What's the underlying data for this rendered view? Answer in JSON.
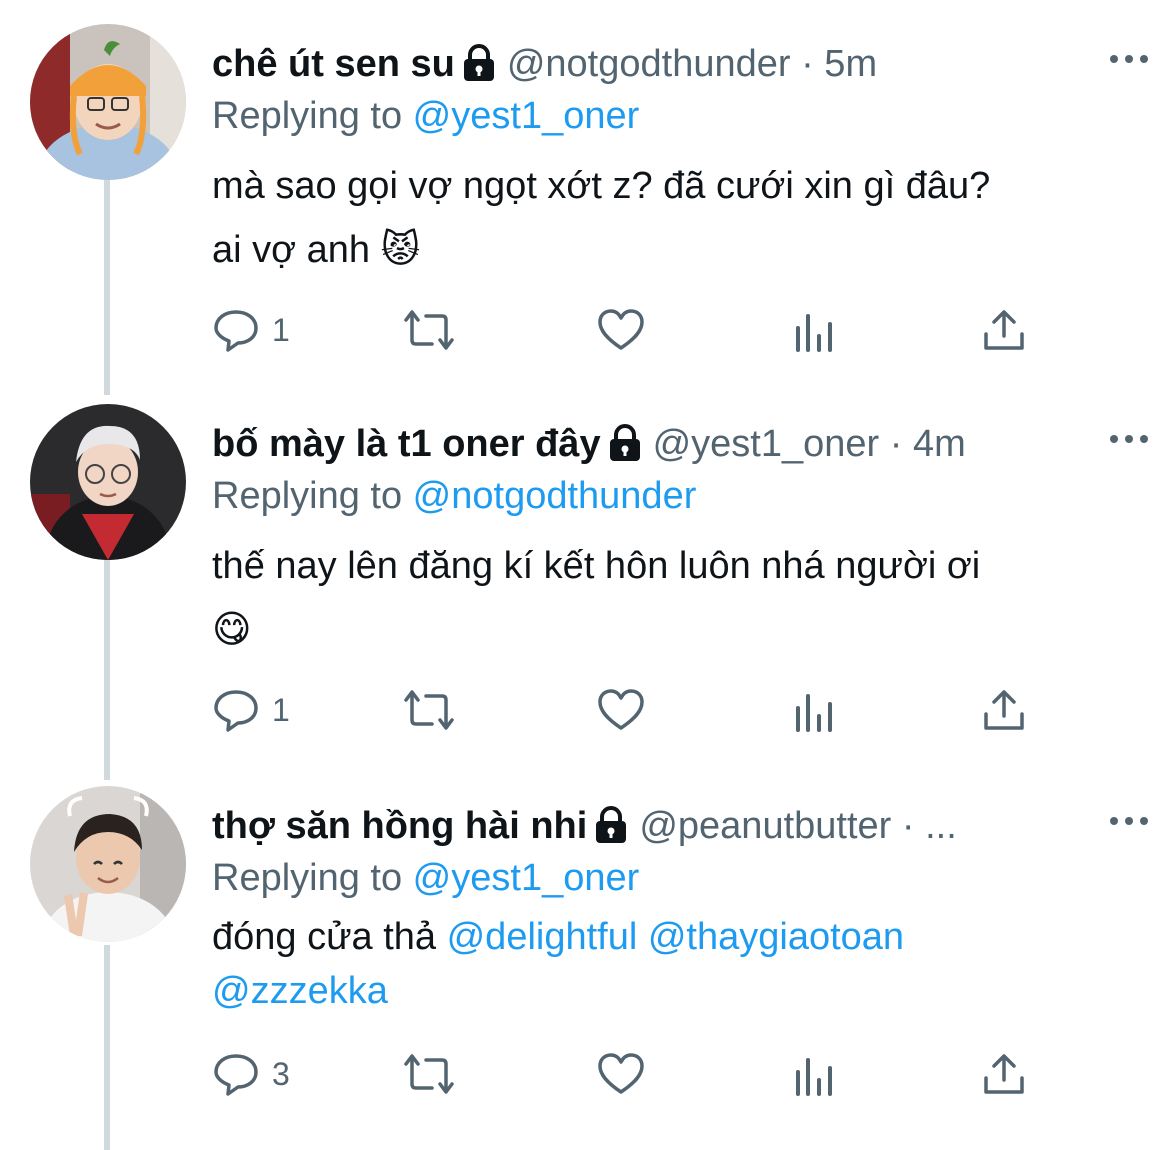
{
  "accent_color": "#1d9bf0",
  "text_color": "#0f1419",
  "muted_color": "#536471",
  "tweets": [
    {
      "name": "chê út sen su",
      "handle": "@notgodthunder",
      "time": "· 5m",
      "replying_prefix": "Replying to ",
      "replying_to": "@yest1_oner",
      "text_line1": "mà sao gọi vợ ngọt xớt z? đã cưới xin gì đâu?",
      "text_line2": "ai vợ anh 😾",
      "reply_count": "1",
      "avatar": "avatar-orange-hat-photo"
    },
    {
      "name": "bố mày là t1 oner đây",
      "handle": "@yest1_oner",
      "time": "· 4m",
      "replying_prefix": "Replying to ",
      "replying_to": "@notgodthunder",
      "text_line1": "thế nay lên đăng kí kết hôn luôn nhá người ơi",
      "text_line2": "😋",
      "reply_count": "1",
      "avatar": "avatar-white-hair-photo"
    },
    {
      "name": "thợ săn hồng hài nhi",
      "handle": "@peanutbutter",
      "time": "· ...",
      "replying_prefix": "Replying to ",
      "replying_to": "@yest1_oner",
      "text_prefix": "đóng cửa thả ",
      "mention1": "@delightful",
      "mention2": "@thaygiaotoan",
      "mention3": "@zzzekka",
      "reply_count": "3",
      "avatar": "avatar-peace-sign-photo"
    }
  ],
  "icons": [
    "lock-icon",
    "more-icon",
    "reply-icon",
    "retweet-icon",
    "like-icon",
    "analytics-icon",
    "share-icon"
  ]
}
